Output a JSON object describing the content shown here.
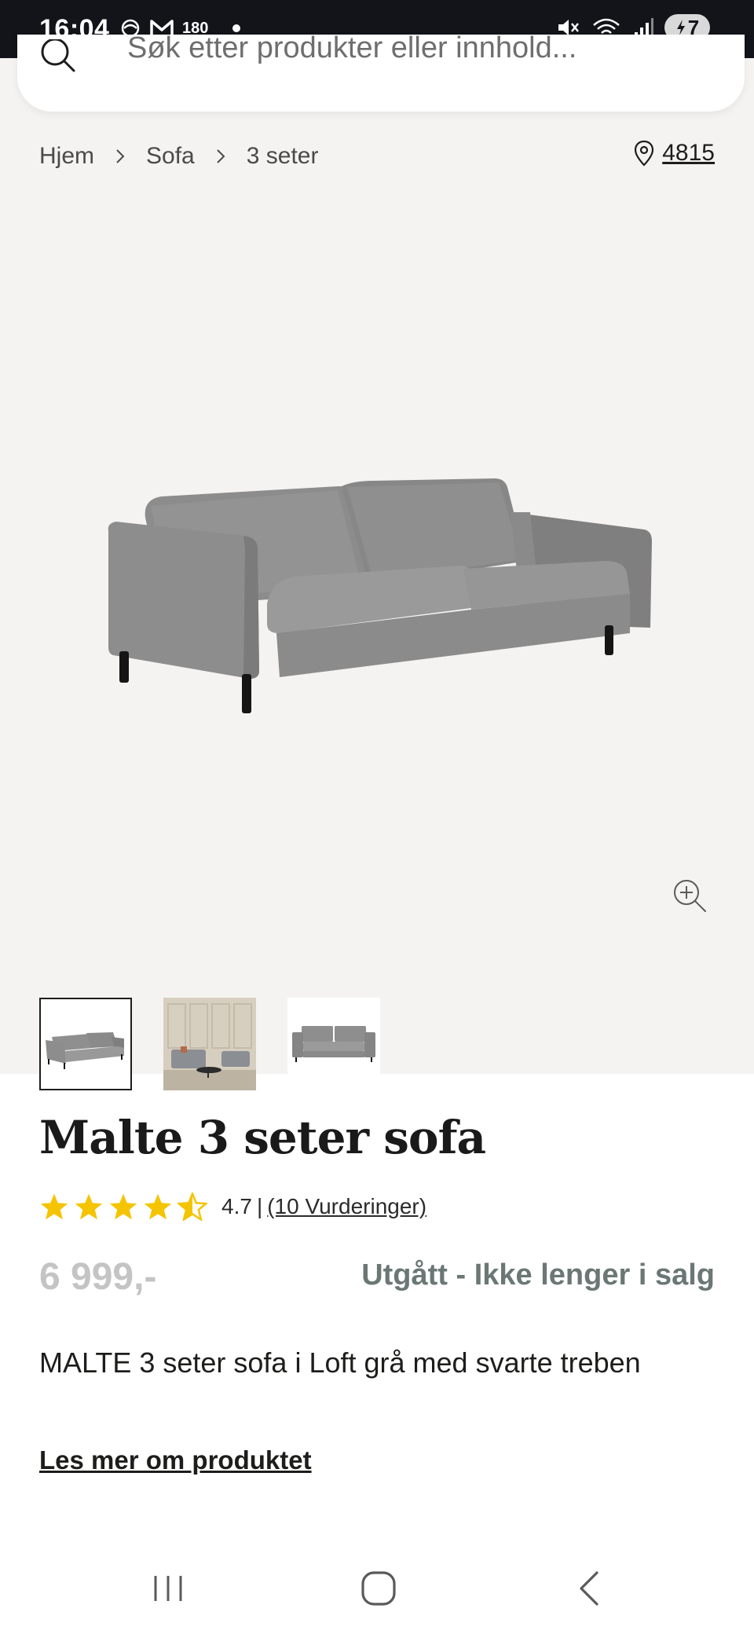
{
  "status_bar": {
    "time": "16:04",
    "mail_count": "180",
    "battery_level": "7",
    "icons": [
      "wind-icon",
      "gmail-icon",
      "dot-icon",
      "mute-icon",
      "wifi-6e-icon",
      "signal-icon",
      "battery-charging-icon"
    ]
  },
  "search": {
    "placeholder": "Søk etter produkter eller innhold...",
    "icon": "search-icon"
  },
  "breadcrumb": {
    "items": [
      "Hjem",
      "Sofa",
      "3 seter"
    ]
  },
  "location": {
    "zip": "4815",
    "icon": "location-pin-icon"
  },
  "gallery": {
    "zoom_icon": "zoom-in-icon",
    "thumbnails": [
      "sofa-front",
      "sofa-room",
      "sofa-straight"
    ],
    "selected_index": 0
  },
  "product": {
    "title": "Malte 3 seter sofa",
    "rating_value": "4.7",
    "rating_separator": "|",
    "rating_count": "(10 Vurderinger)",
    "rating_stars": 4.7,
    "price": "6 999,-",
    "availability": "Utgått - Ikke lenger i salg",
    "description": "MALTE 3 seter sofa i Loft grå med svarte treben",
    "read_more": "Les mer om produktet"
  },
  "colors": {
    "star": "#f5c400",
    "price_disabled": "#c4c4c4",
    "availability": "#6b7775",
    "hero_background": "#f5f3f1"
  },
  "navigation": {
    "icons": [
      "recent-apps-icon",
      "home-icon",
      "back-icon"
    ]
  }
}
